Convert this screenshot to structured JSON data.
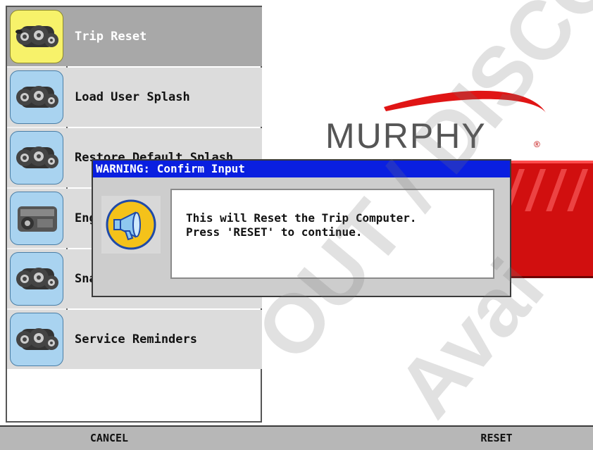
{
  "menu": {
    "items": [
      {
        "label": "Trip Reset",
        "icon": "engine-block-icon",
        "selected": true
      },
      {
        "label": "Load User Splash",
        "icon": "engine-block-icon",
        "selected": false
      },
      {
        "label": "Restore Default Splash",
        "icon": "engine-block-icon",
        "selected": false
      },
      {
        "label": "Engine",
        "icon": "engine-side-icon",
        "selected": false
      },
      {
        "label": "Snapshot",
        "icon": "engine-block-icon",
        "selected": false
      },
      {
        "label": "Service Reminders",
        "icon": "engine-block-icon",
        "selected": false
      }
    ]
  },
  "logo": {
    "text": "MURPHY",
    "reg_mark": "®"
  },
  "dialog": {
    "title": "WARNING: Confirm Input",
    "icon": "megaphone-icon",
    "message": "This will Reset the Trip Computer.\nPress 'RESET' to continue."
  },
  "softkeys": {
    "cancel": "CANCEL",
    "reset": "RESET"
  },
  "watermark": {
    "line1": "OUT / DISCO",
    "line2": "Avai"
  },
  "colors": {
    "selected_tile": "#f7f26a",
    "tile": "#a9d3f0",
    "dialog_title_bg": "#0a1fe0",
    "banner_red": "#d10f0f",
    "logo_swoosh": "#e01515"
  }
}
